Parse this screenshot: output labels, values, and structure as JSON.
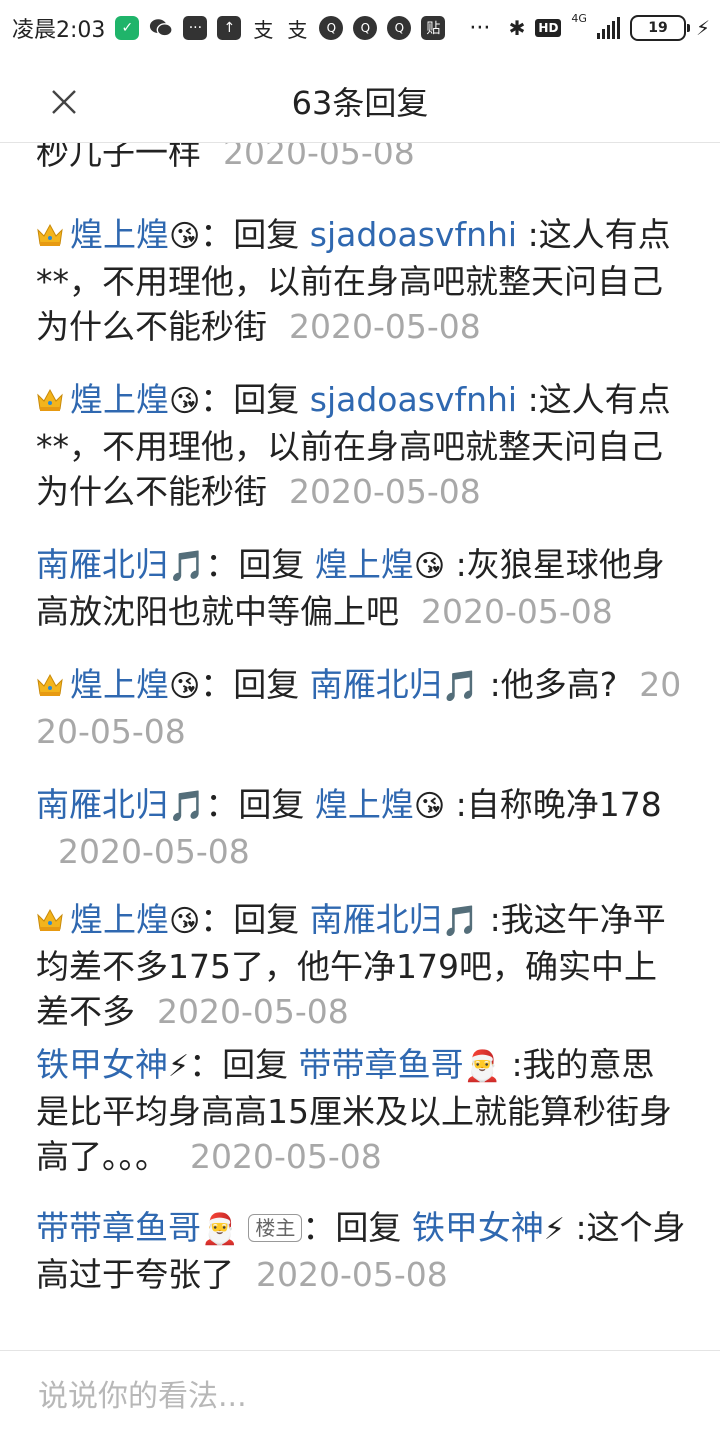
{
  "status_bar": {
    "time": "凌晨2:03",
    "icons": [
      "shield-icon",
      "wechat-icon",
      "message-icon",
      "upload-icon",
      "alipay-icon",
      "alipay-icon",
      "qq-icon",
      "qq-icon",
      "qq-icon",
      "paste-icon",
      "more-dots-icon"
    ],
    "paste_label": "贴",
    "more_label": "···",
    "bluetooth": "✱",
    "hd_label": "HD",
    "network_label": "4G",
    "battery_level": "19",
    "charging": "⚡"
  },
  "header": {
    "close_label": "×",
    "title": "63条回复"
  },
  "first_partial": {
    "text": "秒儿子一样",
    "date": "2020-05-08"
  },
  "replies": [
    {
      "user": "煌上煌",
      "user_emoji": "😘",
      "badge": "crown",
      "verb": "回复",
      "target": "sjadoasvfnhi",
      "target_emoji": "",
      "text": ":这人有点**，不用理他，以前在身高吧就整天问自己为什么不能秒街",
      "date": "2020-05-08"
    },
    {
      "user": "煌上煌",
      "user_emoji": "😘",
      "badge": "crown",
      "verb": "回复",
      "target": "sjadoasvfnhi",
      "target_emoji": "",
      "text": ":这人有点**，不用理他，以前在身高吧就整天问自己为什么不能秒街",
      "date": "2020-05-08"
    },
    {
      "user": "南雁北归",
      "user_emoji": "🎵",
      "badge": "",
      "verb": "回复",
      "target": "煌上煌",
      "target_emoji": "😘",
      "text": ":灰狼星球他身高放沈阳也就中等偏上吧",
      "date": "2020-05-08"
    },
    {
      "user": "煌上煌",
      "user_emoji": "😘",
      "badge": "crown",
      "verb": "回复",
      "target": "南雁北归",
      "target_emoji": "🎵",
      "text": ":他多高?",
      "date": "2020-05-08"
    },
    {
      "user": "南雁北归",
      "user_emoji": "🎵",
      "badge": "",
      "verb": "回复",
      "target": "煌上煌",
      "target_emoji": "😘",
      "text": ":自称晚净178",
      "date": "2020-05-08"
    },
    {
      "user": "煌上煌",
      "user_emoji": "😘",
      "badge": "crown",
      "verb": "回复",
      "target": "南雁北归",
      "target_emoji": "🎵",
      "text": ":我这午净平均差不多175了，他午净179吧，确实中上差不多",
      "date": "2020-05-08"
    },
    {
      "user": "铁甲女神",
      "user_emoji": "⚡",
      "badge": "",
      "verb": "回复",
      "target": "带带章鱼哥",
      "target_emoji": "🎅",
      "text": ":我的意思是比平均身高高15厘米及以上就能算秒街身高了。。。",
      "date": "2020-05-08"
    },
    {
      "user": "带带章鱼哥",
      "user_emoji": "🎅",
      "badge": "楼主",
      "verb": "回复",
      "target": "铁甲女神",
      "target_emoji": "⚡",
      "text": ":这个身高过于夸张了",
      "date": "2020-05-08"
    }
  ],
  "input": {
    "placeholder": "说说你的看法..."
  },
  "colors": {
    "username": "#2f68b0",
    "date": "#a8a8a8",
    "text": "#222222",
    "divider": "#e4e4e4"
  }
}
